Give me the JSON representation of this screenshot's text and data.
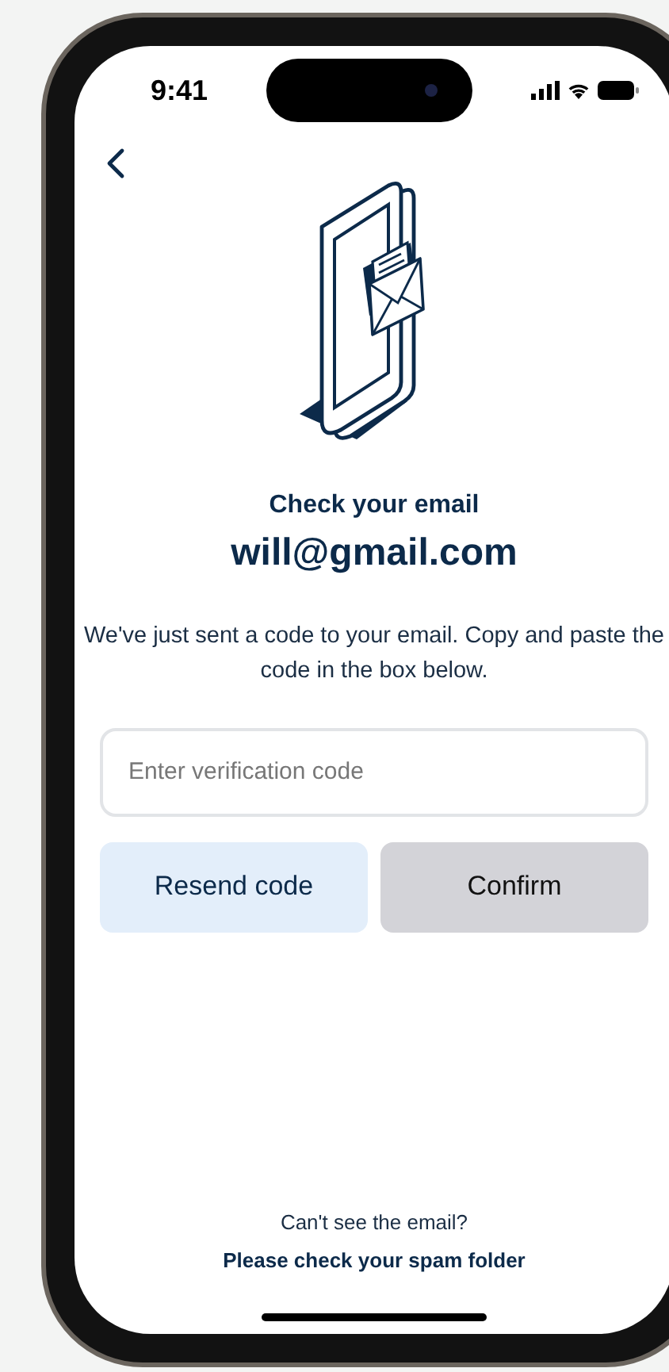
{
  "status_bar": {
    "time": "9:41"
  },
  "title": "Check your email",
  "email": "will@gmail.com",
  "message": "We've just sent a code to your email. Copy and paste the code in the box below.",
  "code_field": {
    "placeholder": "Enter verification code"
  },
  "buttons": [
    {
      "label": "Resend code",
      "kind": "secondary",
      "disabled": false
    },
    {
      "label": "Confirm",
      "kind": "primary",
      "disabled": true
    }
  ],
  "footer": {
    "question": "Can't see the email?",
    "hint": "Please check your spam folder"
  }
}
